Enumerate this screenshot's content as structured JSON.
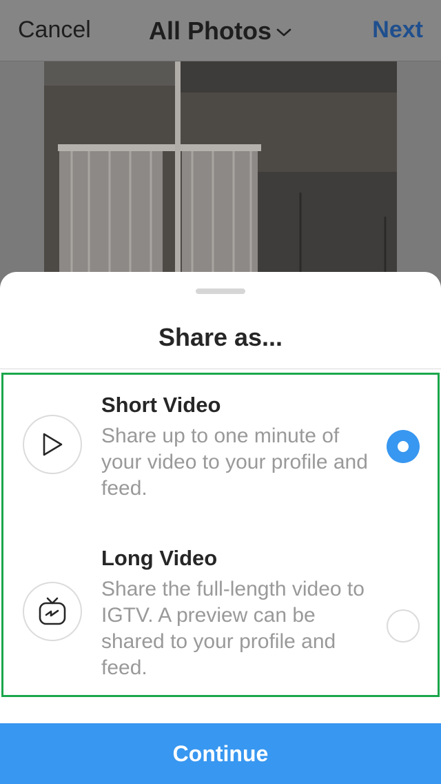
{
  "nav": {
    "cancel_label": "Cancel",
    "title": "All Photos",
    "next_label": "Next"
  },
  "sheet": {
    "title": "Share as...",
    "options": [
      {
        "title": "Short Video",
        "description": "Share up to one minute of your video to your profile and feed.",
        "icon": "play-icon",
        "selected": true
      },
      {
        "title": "Long Video",
        "description": "Share the full-length video to IGTV. A preview can be shared to your profile and feed.",
        "icon": "igtv-icon",
        "selected": false
      }
    ],
    "continue_label": "Continue"
  },
  "colors": {
    "accent": "#3897f0",
    "highlight_border": "#1aa64b",
    "secondary_text": "#999999"
  }
}
